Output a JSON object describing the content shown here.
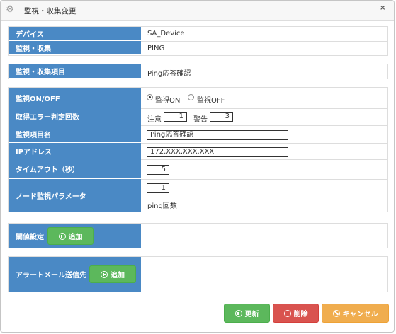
{
  "window": {
    "title": "監視・収集変更",
    "icon": "gear-icon",
    "close_label": "×"
  },
  "device_section": {
    "device_label": "デバイス",
    "device_value": "SA_Device",
    "monitor_label": "監視・収集",
    "monitor_value": "PING"
  },
  "item_section": {
    "label": "監視・収集項目",
    "value": "Ping応答確認"
  },
  "settings": {
    "onoff_label": "監視ON/OFF",
    "on_option": "監視ON",
    "off_option": "監視OFF",
    "selected": "監視ON",
    "error_label": "取得エラー判定回数",
    "warn_label": "注意",
    "warn_value": "1",
    "alert_label": "警告",
    "alert_value": "3",
    "name_label": "監視項目名",
    "name_value": "Ping応答確認",
    "ip_label": "IPアドレス",
    "ip_value": "172.XXX.XXX.XXX",
    "timeout_label": "タイムアウト（秒）",
    "timeout_value": "5",
    "param_label": "ノード監視パラメータ",
    "param_value": "1",
    "param_unit": "ping回数"
  },
  "threshold": {
    "label": "閾値設定",
    "add_label": "追加"
  },
  "alert_mail": {
    "label": "アラートメール送信先",
    "add_label": "追加"
  },
  "footer": {
    "update_label": "更新",
    "delete_label": "削除",
    "cancel_label": "キャンセル"
  },
  "colors": {
    "label_bg": "#4a89c5",
    "green": "#5cb85c",
    "red": "#d9534f",
    "orange": "#f0ad4e"
  }
}
